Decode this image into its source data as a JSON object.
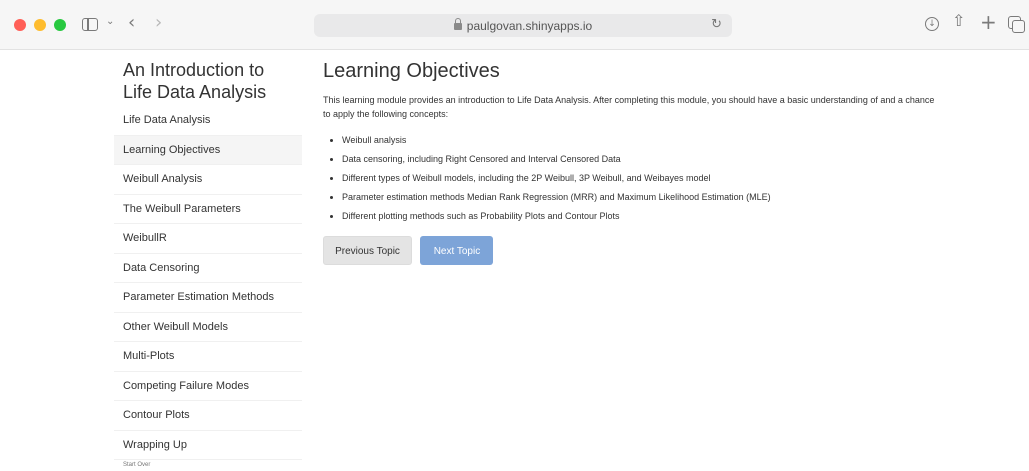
{
  "browser": {
    "url": "paulgovan.shinyapps.io",
    "icons": [
      "close-dot",
      "minimize-dot",
      "zoom-dot",
      "sidebar-icon",
      "chevron-down-icon",
      "back-arrow-icon",
      "forward-arrow-icon",
      "lock-icon",
      "reload-icon",
      "download-icon",
      "share-icon",
      "plus-icon",
      "tabs-overview-icon"
    ],
    "glyphs": {
      "chevron_down": "⌄",
      "back": "‹",
      "forward": "›",
      "reload": "↻",
      "download": "↓",
      "share": "⇧",
      "plus": "+"
    }
  },
  "sidebar": {
    "title": "An Introduction to Life Data Analysis",
    "items": [
      {
        "label": "Life Data Analysis",
        "active": false
      },
      {
        "label": "Learning Objectives",
        "active": true
      },
      {
        "label": "Weibull Analysis",
        "active": false
      },
      {
        "label": "The Weibull Parameters",
        "active": false
      },
      {
        "label": "WeibullR",
        "active": false
      },
      {
        "label": "Data Censoring",
        "active": false
      },
      {
        "label": "Parameter Estimation Methods",
        "active": false
      },
      {
        "label": "Other Weibull Models",
        "active": false
      },
      {
        "label": "Multi-Plots",
        "active": false
      },
      {
        "label": "Competing Failure Modes",
        "active": false
      },
      {
        "label": "Contour Plots",
        "active": false
      },
      {
        "label": "Wrapping Up",
        "active": false
      }
    ],
    "start_over": "Start Over"
  },
  "main": {
    "heading": "Learning Objectives",
    "intro": "This learning module provides an introduction to Life Data Analysis. After completing this module, you should have a basic understanding of and a chance to apply the following concepts:",
    "objectives": [
      "Weibull analysis",
      "Data censoring, including Right Censored and Interval Censored Data",
      "Different types of Weibull models, including the 2P Weibull, 3P Weibull, and Weibayes model",
      "Parameter estimation methods Median Rank Regression (MRR) and Maximum Likelihood Estimation (MLE)",
      "Different plotting methods such as Probability Plots and Contour Plots"
    ],
    "prev_label": "Previous Topic",
    "next_label": "Next Topic"
  },
  "colors": {
    "next_button": "#7da4d8",
    "prev_button": "#e4e4e4",
    "active_item": "#f5f5f5"
  }
}
